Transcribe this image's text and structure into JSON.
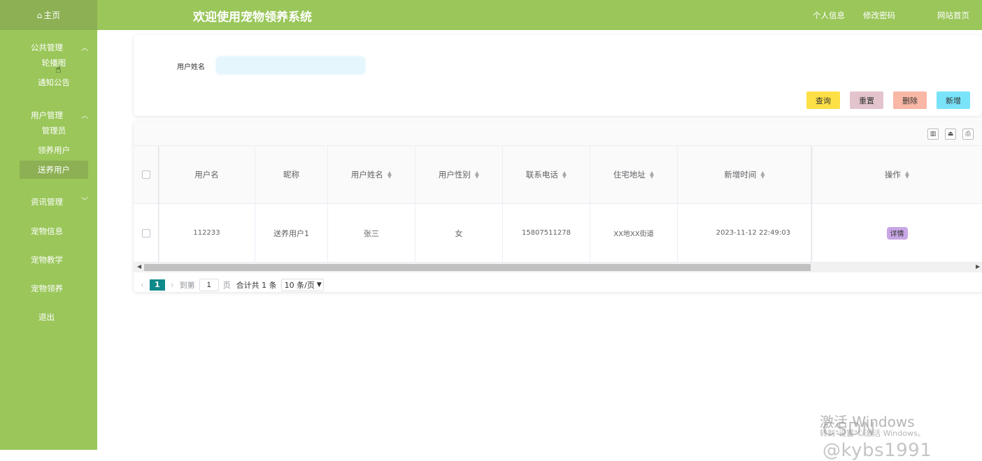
{
  "header": {
    "title": "欢迎使用宠物领养系统",
    "links": [
      "个人信息",
      "修改密码",
      "网站首页"
    ]
  },
  "sidebar": {
    "home": "主页",
    "home_icon": "home-icon",
    "groups": [
      {
        "title": "公共管理",
        "items": [
          "轮播图",
          "通知公告"
        ]
      },
      {
        "title": "用户管理",
        "items": [
          "管理员",
          "领养用户",
          "送养用户"
        ]
      },
      {
        "title": "资讯管理",
        "items": []
      }
    ],
    "single_items": [
      "宠物信息",
      "宠物教学",
      "宠物领养",
      "退出"
    ],
    "active_item": "送养用户"
  },
  "search": {
    "label": "用户姓名",
    "value": "",
    "buttons": {
      "query": "查询",
      "reset": "重置",
      "delete": "删除",
      "add": "新增"
    }
  },
  "colors": {
    "sidebar_bg": "#9ac65a",
    "sidebar_active": "#8cb053",
    "btn_query": "#fde046",
    "btn_reset": "#e3c4cd",
    "btn_delete": "#f9b7a5",
    "btn_add": "#79e3f9",
    "detail_btn": "#c9a7e6",
    "pager_active": "#0f8a8a"
  },
  "table": {
    "columns": [
      "用户名",
      "昵称",
      "用户姓名",
      "用户性别",
      "联系电话",
      "住宅地址",
      "新增时间",
      "操作"
    ],
    "rows": [
      {
        "username": "112233",
        "nickname": "送养用户1",
        "name": "张三",
        "gender": "女",
        "phone": "15807511278",
        "address": "XX地XX街道",
        "created": "2023-11-12 22:49:03",
        "action": "详情"
      }
    ]
  },
  "pagination": {
    "current_page": "1",
    "goto_label": "到第",
    "goto_value": "1",
    "page_suffix": "页",
    "total": "合计共 1 条",
    "page_size": "10 条/页"
  },
  "watermark": {
    "line1": "激活 Windows",
    "line2": "转到\"设置\"以激活 Windows。",
    "csdn": "CSDN @kybs1991"
  }
}
